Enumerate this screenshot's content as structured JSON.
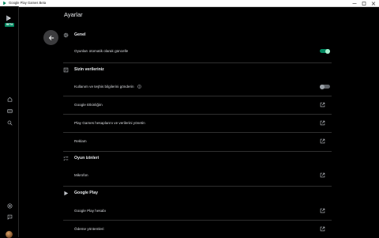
{
  "window": {
    "title": "Google Play Games Beta",
    "minimize_icon": "minimize-icon",
    "maximize_icon": "maximize-icon",
    "close_icon": "close-icon"
  },
  "rail": {
    "badge": "BETA",
    "icons": [
      "home-icon",
      "library-icon",
      "search-icon",
      "add-game-icon",
      "feedback-icon",
      "profile-avatar"
    ]
  },
  "header": {
    "title": "Ayarlar",
    "back_icon": "arrow-back-icon"
  },
  "sections": {
    "general": {
      "icon": "gear-icon",
      "title": "Genel",
      "auto_update": {
        "label": "Oyunları otomatik olarak güncelle",
        "enabled": true
      }
    },
    "data": {
      "icon": "document-icon",
      "title": "Sizin verileriniz",
      "usage_stats": {
        "label": "Kullanım ve teşhis bilgilerini gönderin",
        "enabled": false
      },
      "activity": "Google Etkinliğim",
      "accounts": "Play Games hesaplarını ve verilerini yönetin",
      "ads": "Reklam"
    },
    "permissions": {
      "icon": "permissions-icon",
      "title": "Oyun izinleri",
      "microphone": "Mikrofon"
    },
    "google_play": {
      "icon": "play-icon",
      "title": "Google Play",
      "account": "Google Play hesabı",
      "payments": "Ödeme yöntemleri"
    }
  },
  "colors": {
    "background": "#000000",
    "accent_green": "#01875f",
    "text": "#e8eaed",
    "divider": "#2f2f2f"
  }
}
